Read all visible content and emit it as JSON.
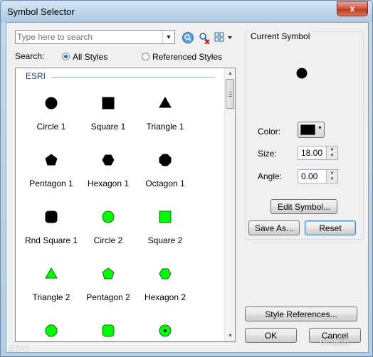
{
  "window": {
    "title": "Symbol Selector",
    "close_label": "x"
  },
  "search": {
    "placeholder": "Type here to search",
    "scope_label": "Search:",
    "option_all": "All Styles",
    "option_referenced": "Referenced Styles",
    "selected": "All Styles"
  },
  "list": {
    "group": "ESRI",
    "symbols": [
      {
        "label": "Circle 1",
        "shape": "circle",
        "color": "#000000"
      },
      {
        "label": "Square 1",
        "shape": "square",
        "color": "#000000"
      },
      {
        "label": "Triangle 1",
        "shape": "triangle",
        "color": "#000000"
      },
      {
        "label": "Pentagon 1",
        "shape": "pentagon",
        "color": "#000000"
      },
      {
        "label": "Hexagon 1",
        "shape": "hexagon",
        "color": "#000000"
      },
      {
        "label": "Octagon 1",
        "shape": "octagon",
        "color": "#000000"
      },
      {
        "label": "Rnd Square 1",
        "shape": "rounded-square",
        "color": "#000000"
      },
      {
        "label": "Circle 2",
        "shape": "circle",
        "color": "#00ff00"
      },
      {
        "label": "Square 2",
        "shape": "square",
        "color": "#00ff00"
      },
      {
        "label": "Triangle 2",
        "shape": "triangle",
        "color": "#00ff00"
      },
      {
        "label": "Pentagon 2",
        "shape": "pentagon",
        "color": "#00ff00"
      },
      {
        "label": "Hexagon 2",
        "shape": "hexagon",
        "color": "#00ff00"
      },
      {
        "label": "",
        "shape": "octagon",
        "color": "#00ff00"
      },
      {
        "label": "",
        "shape": "rounded-square",
        "color": "#00ff00"
      },
      {
        "label": "",
        "shape": "circle-dot",
        "color": "#00ff00"
      }
    ]
  },
  "current_symbol": {
    "title": "Current Symbol",
    "preview_color": "#000000",
    "color_label": "Color:",
    "color_value": "#000000",
    "size_label": "Size:",
    "size_value": "18.00",
    "angle_label": "Angle:",
    "angle_value": "0.00",
    "edit_button": "Edit Symbol...",
    "save_as_button": "Save As...",
    "reset_button": "Reset"
  },
  "footer": {
    "style_references_button": "Style References...",
    "ok_button": "OK",
    "cancel_button": "Cancel"
  },
  "watermarks": {
    "left": "众GIS",
    "right": "GIS前沿"
  }
}
